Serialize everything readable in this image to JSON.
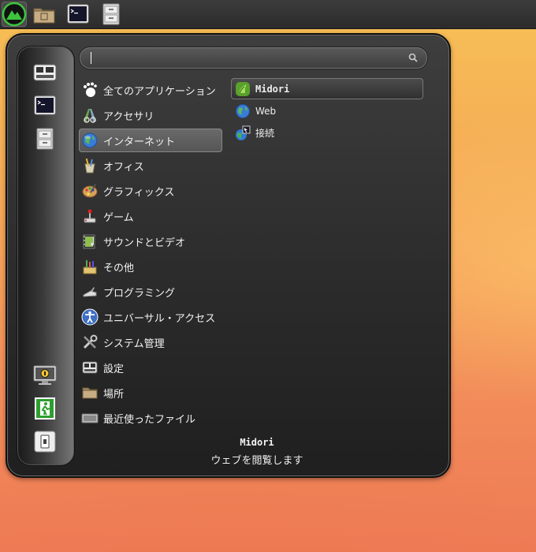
{
  "panel": {
    "launchers": [
      "menu-logo-icon",
      "home-folder-icon",
      "terminal-icon",
      "file-cabinet-icon"
    ]
  },
  "menu": {
    "search": {
      "value": "",
      "placeholder": ""
    },
    "favorites": [
      "system-settings-icon",
      "terminal-icon",
      "file-cabinet-icon"
    ],
    "session": [
      "lock-screen-icon",
      "logout-icon",
      "shutdown-icon"
    ],
    "categories": [
      {
        "label": "全てのアプリケーション",
        "icon": "all-applications-icon"
      },
      {
        "label": "アクセサリ",
        "icon": "accessories-icon"
      },
      {
        "label": "インターネット",
        "icon": "internet-icon",
        "selected": true
      },
      {
        "label": "オフィス",
        "icon": "office-icon"
      },
      {
        "label": "グラフィックス",
        "icon": "graphics-icon"
      },
      {
        "label": "ゲーム",
        "icon": "games-icon"
      },
      {
        "label": "サウンドとビデオ",
        "icon": "multimedia-icon"
      },
      {
        "label": "その他",
        "icon": "other-icon"
      },
      {
        "label": "プログラミング",
        "icon": "programming-icon"
      },
      {
        "label": "ユニバーサル・アクセス",
        "icon": "accessibility-icon"
      },
      {
        "label": "システム管理",
        "icon": "system-tools-icon"
      },
      {
        "label": "設定",
        "icon": "settings-icon"
      },
      {
        "label": "場所",
        "icon": "places-icon"
      },
      {
        "label": "最近使ったファイル",
        "icon": "recent-files-icon"
      }
    ],
    "apps": [
      {
        "label": "Midori",
        "icon": "midori-icon",
        "selected": true
      },
      {
        "label": "Web",
        "icon": "web-globe-icon"
      },
      {
        "label": "接続",
        "icon": "network-connect-icon"
      }
    ],
    "description": {
      "title": "Midori",
      "text": "ウェブを閲覧します"
    }
  },
  "colors": {
    "menu_bg": "#2d2d2d",
    "selection": "#5e5e5e",
    "wallpaper_top": "#f7c055",
    "wallpaper_bottom": "#ee7a55"
  }
}
